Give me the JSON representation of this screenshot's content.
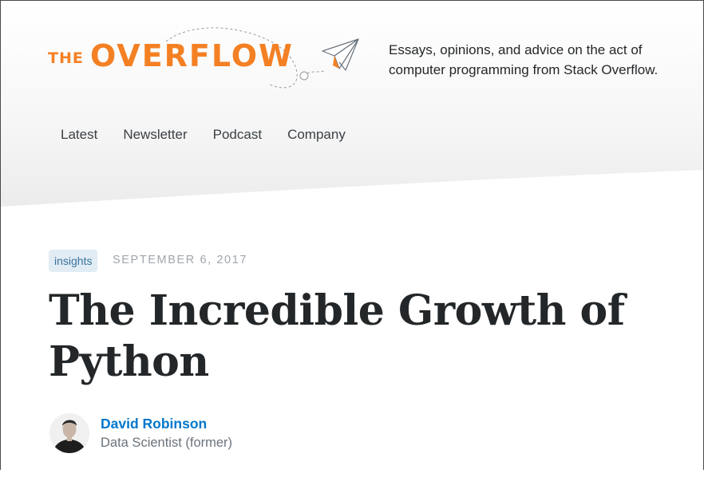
{
  "logo": {
    "the": "THE",
    "word": "OVERFLOW"
  },
  "tagline": "Essays, opinions, and advice on the act of computer programming from Stack Overflow.",
  "nav": {
    "items": [
      {
        "label": "Latest"
      },
      {
        "label": "Newsletter"
      },
      {
        "label": "Podcast"
      },
      {
        "label": "Company"
      }
    ]
  },
  "post": {
    "tag": "insights",
    "date": "SEPTEMBER 6, 2017",
    "title_line1": "The Incredible Growth of",
    "title_line2": "Python",
    "author": {
      "name": "David Robinson",
      "role": "Data Scientist (former)"
    }
  },
  "colors": {
    "brand_orange": "#f48024",
    "link_blue": "#0077cc",
    "tag_bg": "#e1ecf4",
    "tag_text": "#39739d"
  },
  "icons": {
    "logo_plane": "paper-plane-icon",
    "avatar": "author-avatar"
  }
}
